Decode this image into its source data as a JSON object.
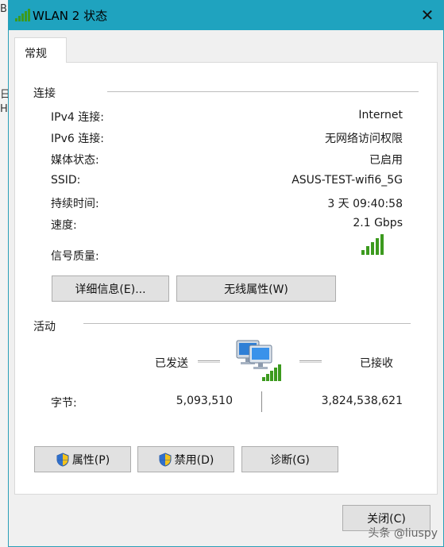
{
  "window": {
    "title": "WLAN 2 状态"
  },
  "tabs": [
    {
      "label": "常规"
    }
  ],
  "connection": {
    "section_label": "连接",
    "rows": [
      {
        "label": "IPv4 连接:",
        "value": "Internet"
      },
      {
        "label": "IPv6 连接:",
        "value": "无网络访问权限"
      },
      {
        "label": "媒体状态:",
        "value": "已启用"
      },
      {
        "label": "SSID:",
        "value": "ASUS-TEST-wifi6_5G"
      },
      {
        "label": "持续时间:",
        "value": "3 天 09:40:58"
      },
      {
        "label": "速度:",
        "value": "2.1 Gbps"
      }
    ],
    "signal_label": "信号质量:",
    "signal_bars": 5,
    "details_button": "详细信息(E)...",
    "wireless_button": "无线属性(W)"
  },
  "activity": {
    "section_label": "活动",
    "sent_label": "已发送",
    "received_label": "已接收",
    "bytes_label": "字节:",
    "bytes_sent": "5,093,510",
    "bytes_received": "3,824,538,621"
  },
  "actions": {
    "properties": "属性(P)",
    "disable": "禁用(D)",
    "diagnose": "诊断(G)"
  },
  "close_button": "关闭(C)",
  "watermark": "头条 @liuspy",
  "background_fragments": [
    "B",
    "日",
    "H"
  ],
  "colors": {
    "titlebar": "#1fa3bf",
    "signal": "#3c9a1e"
  }
}
